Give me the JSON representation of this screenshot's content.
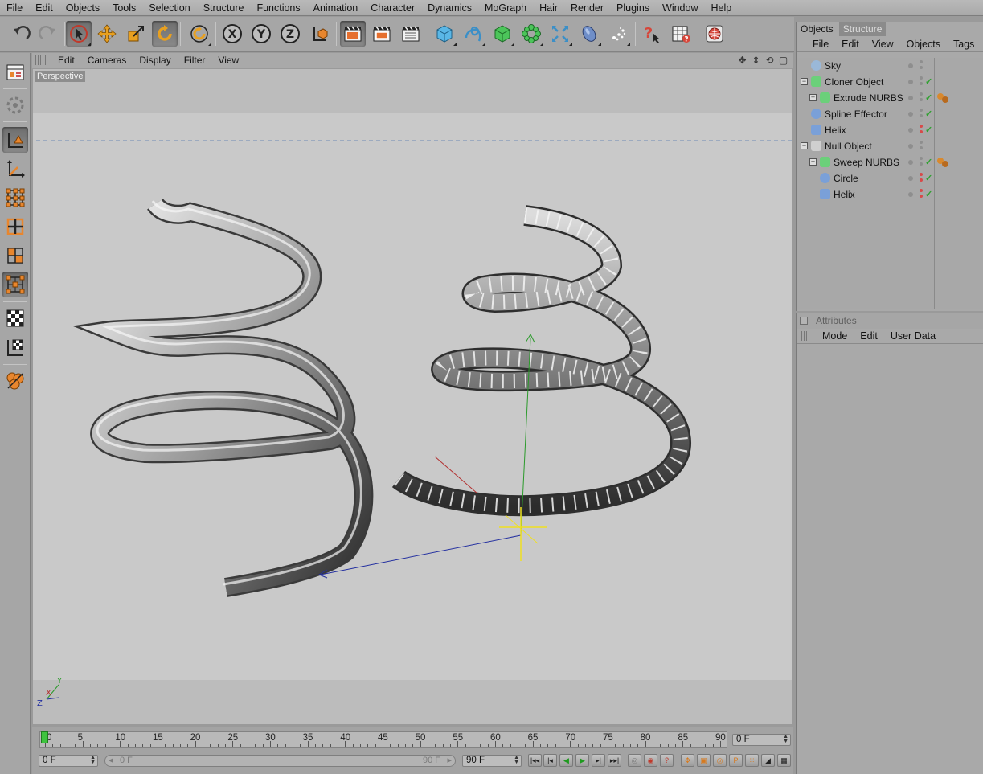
{
  "menubar": [
    "File",
    "Edit",
    "Objects",
    "Tools",
    "Selection",
    "Structure",
    "Functions",
    "Animation",
    "Character",
    "Dynamics",
    "MoGraph",
    "Hair",
    "Render",
    "Plugins",
    "Window",
    "Help"
  ],
  "toolbar": {
    "icons": [
      "undo-icon",
      "redo-icon",
      "live-selection-icon",
      "move-icon",
      "scale-icon",
      "rotate-icon",
      "recent-tool-icon",
      "x-axis-lock-icon",
      "y-axis-lock-icon",
      "z-axis-lock-icon",
      "coordinate-system-icon",
      "render-active-view-icon",
      "render-to-picture-viewer-icon",
      "render-settings-icon",
      "cube-primitive-icon",
      "spline-tool-icon",
      "nurbs-icon",
      "array-icon",
      "deformer-icon",
      "environment-icon",
      "camera-icon",
      "light-icon",
      "help-icon",
      "content-browser-icon",
      "internet-icon"
    ],
    "x_label": "X",
    "y_label": "Y",
    "z_label": "Z"
  },
  "viewport": {
    "menu": [
      "Edit",
      "Cameras",
      "Display",
      "Filter",
      "View"
    ],
    "label": "Perspective",
    "nav_icons": [
      "move-view-icon",
      "dolly-view-icon",
      "rotate-view-icon",
      "toggle-view-icon"
    ],
    "axis_labels": {
      "x": "X",
      "y": "Y",
      "z": "Z"
    }
  },
  "timeline": {
    "ticks": [
      "0",
      "5",
      "10",
      "15",
      "20",
      "25",
      "30",
      "35",
      "40",
      "45",
      "50",
      "55",
      "60",
      "65",
      "70",
      "75",
      "80",
      "85",
      "90"
    ],
    "current_frame": "0 F",
    "start_frame": "0 F",
    "slider_start": "0 F",
    "slider_end": "90 F",
    "end_frame": "90 F"
  },
  "object_manager": {
    "tabs": [
      "Objects",
      "Structure"
    ],
    "menu": [
      "File",
      "Edit",
      "View",
      "Objects",
      "Tags",
      "B"
    ],
    "objects": [
      {
        "name": "Sky",
        "icon": "sky-icon",
        "color": "#9ab8d8"
      },
      {
        "name": "Cloner Object",
        "icon": "cloner-icon",
        "color": "#6bd07a"
      },
      {
        "name": "Extrude NURBS",
        "icon": "extrude-nurbs-icon",
        "color": "#6bd07a"
      },
      {
        "name": "Spline Effector",
        "icon": "spline-effector-icon",
        "color": "#7aa0d8"
      },
      {
        "name": "Helix",
        "icon": "helix-spline-icon",
        "color": "#7aa0d8"
      },
      {
        "name": "Null Object",
        "icon": "null-object-icon",
        "color": "#cfcfcf"
      },
      {
        "name": "Sweep NURBS",
        "icon": "sweep-nurbs-icon",
        "color": "#6bd07a"
      },
      {
        "name": "Circle",
        "icon": "circle-spline-icon",
        "color": "#7aa0d8"
      },
      {
        "name": "Helix",
        "icon": "helix-spline-icon",
        "color": "#7aa0d8"
      }
    ]
  },
  "attributes": {
    "title": "Attributes",
    "menu": [
      "Mode",
      "Edit",
      "User Data"
    ]
  }
}
